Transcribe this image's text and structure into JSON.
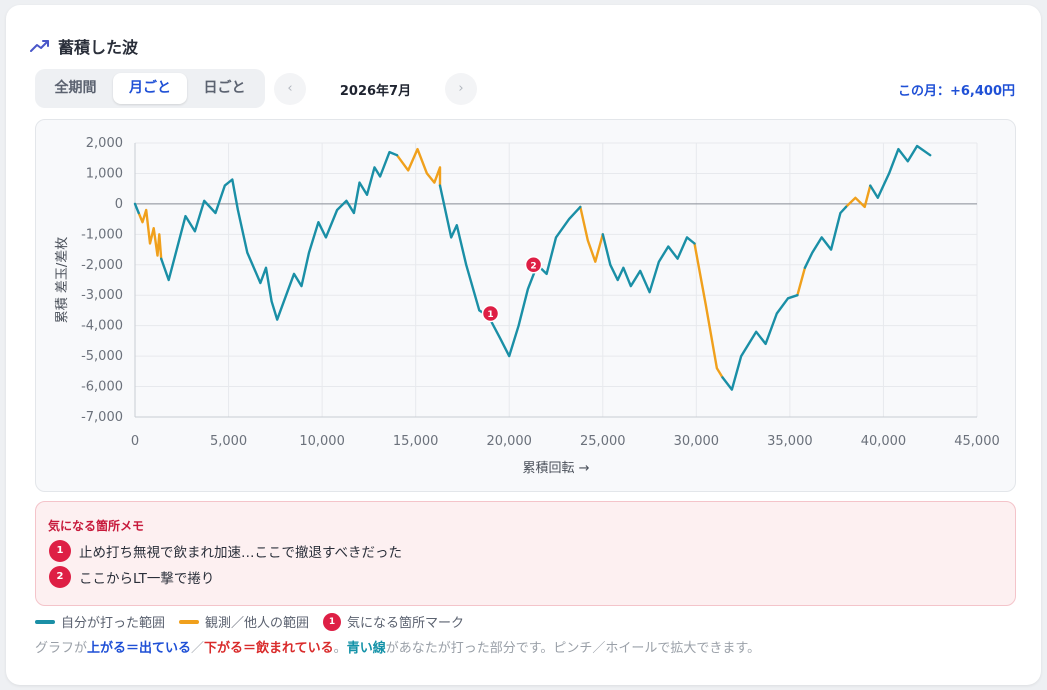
{
  "header": {
    "title": "蓄積した波"
  },
  "tabs": [
    {
      "label": "全期間",
      "active": false
    },
    {
      "label": "月ごと",
      "active": true
    },
    {
      "label": "日ごと",
      "active": false
    }
  ],
  "period": {
    "prev_icon": "‹",
    "next_icon": "›",
    "label": "2026年7月",
    "summary": "この月：+6,400円"
  },
  "colors": {
    "self": "#1a8fa6",
    "observed": "#f0a01c",
    "marker": "#de1f45",
    "accent": "#1f50d6"
  },
  "chart_data": {
    "type": "line",
    "xlabel": "累積回転 →",
    "ylabel": "累積 差玉/差枚",
    "xlim": [
      0,
      45000
    ],
    "ylim": [
      -7000,
      2000
    ],
    "xticks": [
      0,
      5000,
      10000,
      15000,
      20000,
      25000,
      30000,
      35000,
      40000,
      45000
    ],
    "yticks": [
      2000,
      1000,
      0,
      -1000,
      -2000,
      -3000,
      -4000,
      -5000,
      -6000,
      -7000
    ],
    "xtick_labels": [
      "0",
      "5,000",
      "10,000",
      "15,000",
      "20,000",
      "25,000",
      "30,000",
      "35,000",
      "40,000",
      "45,000"
    ],
    "ytick_labels": [
      "2,000",
      "1,000",
      "0",
      "-1,000",
      "-2,000",
      "-3,000",
      "-4,000",
      "-5,000",
      "-6,000",
      "-7,000"
    ],
    "grid": true,
    "series": [
      {
        "name": "自分が打った範囲",
        "segments": [
          [
            [
              0,
              0
            ],
            [
              200,
              -300
            ]
          ],
          [
            [
              1400,
              -1800
            ],
            [
              1800,
              -2500
            ],
            [
              2700,
              -400
            ],
            [
              3200,
              -900
            ],
            [
              3700,
              100
            ],
            [
              4300,
              -300
            ],
            [
              4800,
              600
            ],
            [
              5200,
              800
            ],
            [
              5500,
              -200
            ],
            [
              6000,
              -1600
            ],
            [
              6700,
              -2600
            ],
            [
              7000,
              -2100
            ],
            [
              7300,
              -3200
            ],
            [
              7600,
              -3800
            ],
            [
              8200,
              -2800
            ],
            [
              8500,
              -2300
            ],
            [
              8900,
              -2700
            ],
            [
              9300,
              -1600
            ],
            [
              9800,
              -600
            ],
            [
              10200,
              -1100
            ],
            [
              10800,
              -200
            ],
            [
              11300,
              100
            ],
            [
              11700,
              -300
            ],
            [
              12000,
              700
            ],
            [
              12400,
              300
            ],
            [
              12800,
              1200
            ],
            [
              13100,
              900
            ],
            [
              13600,
              1700
            ],
            [
              14000,
              1600
            ]
          ],
          [
            [
              16300,
              600
            ],
            [
              16900,
              -1100
            ],
            [
              17200,
              -700
            ],
            [
              17700,
              -2000
            ],
            [
              18400,
              -3500
            ],
            [
              18900,
              -3700
            ],
            [
              19500,
              -4400
            ],
            [
              20000,
              -5000
            ],
            [
              20500,
              -4000
            ],
            [
              21000,
              -2800
            ],
            [
              21500,
              -2000
            ],
            [
              22000,
              -2300
            ],
            [
              22500,
              -1100
            ],
            [
              23200,
              -500
            ],
            [
              23800,
              -100
            ]
          ],
          [
            [
              25000,
              -1000
            ],
            [
              25400,
              -2000
            ],
            [
              25800,
              -2500
            ],
            [
              26100,
              -2100
            ],
            [
              26500,
              -2700
            ],
            [
              27000,
              -2200
            ],
            [
              27500,
              -2900
            ],
            [
              28000,
              -1900
            ],
            [
              28500,
              -1400
            ],
            [
              29000,
              -1800
            ],
            [
              29500,
              -1100
            ],
            [
              29900,
              -1300
            ]
          ],
          [
            [
              31400,
              -5700
            ],
            [
              31900,
              -6100
            ],
            [
              32400,
              -5000
            ],
            [
              33200,
              -4200
            ],
            [
              33700,
              -4600
            ],
            [
              34300,
              -3600
            ],
            [
              34900,
              -3100
            ],
            [
              35400,
              -3000
            ]
          ],
          [
            [
              35800,
              -2100
            ],
            [
              36200,
              -1600
            ],
            [
              36700,
              -1100
            ],
            [
              37200,
              -1500
            ],
            [
              37700,
              -300
            ],
            [
              38000,
              -100
            ]
          ],
          [
            [
              39300,
              600
            ],
            [
              39700,
              200
            ],
            [
              40300,
              1000
            ],
            [
              40800,
              1800
            ],
            [
              41300,
              1400
            ],
            [
              41800,
              1900
            ],
            [
              42500,
              1600
            ]
          ]
        ]
      },
      {
        "name": "観測／他人の範囲",
        "segments": [
          [
            [
              200,
              -300
            ],
            [
              400,
              -600
            ],
            [
              600,
              -200
            ],
            [
              800,
              -1300
            ],
            [
              1000,
              -800
            ],
            [
              1200,
              -1700
            ],
            [
              1300,
              -1000
            ],
            [
              1400,
              -1800
            ]
          ],
          [
            [
              14000,
              1600
            ],
            [
              14600,
              1100
            ],
            [
              15100,
              1800
            ],
            [
              15600,
              1000
            ],
            [
              16000,
              700
            ],
            [
              16300,
              1200
            ],
            [
              16300,
              600
            ]
          ],
          [
            [
              23800,
              -100
            ],
            [
              24200,
              -1200
            ],
            [
              24600,
              -1900
            ],
            [
              25000,
              -1000
            ]
          ],
          [
            [
              29900,
              -1300
            ],
            [
              30500,
              -3300
            ],
            [
              31100,
              -5400
            ],
            [
              31400,
              -5700
            ]
          ],
          [
            [
              35400,
              -3000
            ],
            [
              35800,
              -2100
            ]
          ],
          [
            [
              38000,
              -100
            ],
            [
              38500,
              200
            ],
            [
              39000,
              -100
            ],
            [
              39300,
              600
            ]
          ]
        ]
      }
    ],
    "markers": [
      {
        "id": "1",
        "x": 19000,
        "y": -3600
      },
      {
        "id": "2",
        "x": 21300,
        "y": -2000
      }
    ]
  },
  "memo": {
    "title": "気になる箇所メモ",
    "items": [
      {
        "badge": "1",
        "text": "止め打ち無視で飲まれ加速…ここで撤退すべきだった"
      },
      {
        "badge": "2",
        "text": "ここからLT一撃で捲り"
      }
    ]
  },
  "legend": [
    {
      "label": "自分が打った範囲",
      "color": "#1a8fa6",
      "kind": "line"
    },
    {
      "label": "観測／他人の範囲",
      "color": "#f0a01c",
      "kind": "line"
    },
    {
      "badge": "1",
      "label": "気になる箇所マーク",
      "color": "#de1f45",
      "kind": "badge"
    }
  ],
  "hint": {
    "p1": "グラフが",
    "p2": "上がる＝出ている",
    "p3": "／",
    "p4": "下がる＝飲まれている",
    "p5": "。",
    "p6": "青い線",
    "p7": "があなたが打った部分です。ピンチ／ホイールで拡大できます。"
  }
}
